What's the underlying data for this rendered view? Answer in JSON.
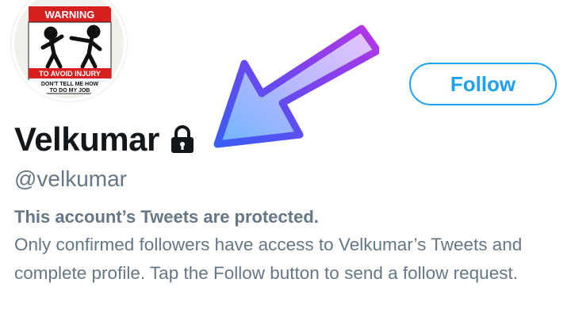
{
  "profile": {
    "display_name": "Velkumar",
    "handle": "@velkumar",
    "avatar": {
      "sign_title": "WARNING",
      "sign_line1": "TO AVOID INJURY",
      "sign_line2": "DON'T TELL ME HOW",
      "sign_line3": "TO DO MY JOB"
    }
  },
  "actions": {
    "follow_label": "Follow"
  },
  "protected_notice": {
    "title": "This account’s Tweets are protected.",
    "body": "Only confirmed followers have access to Velkumar’s Tweets and complete profile. Tap the Follow button to send a follow request."
  },
  "icons": {
    "lock": "lock-icon",
    "annotation_arrow": "arrow-icon"
  },
  "colors": {
    "accent": "#1da1f2",
    "secondary_text": "#657786",
    "primary_text": "#14171a"
  }
}
